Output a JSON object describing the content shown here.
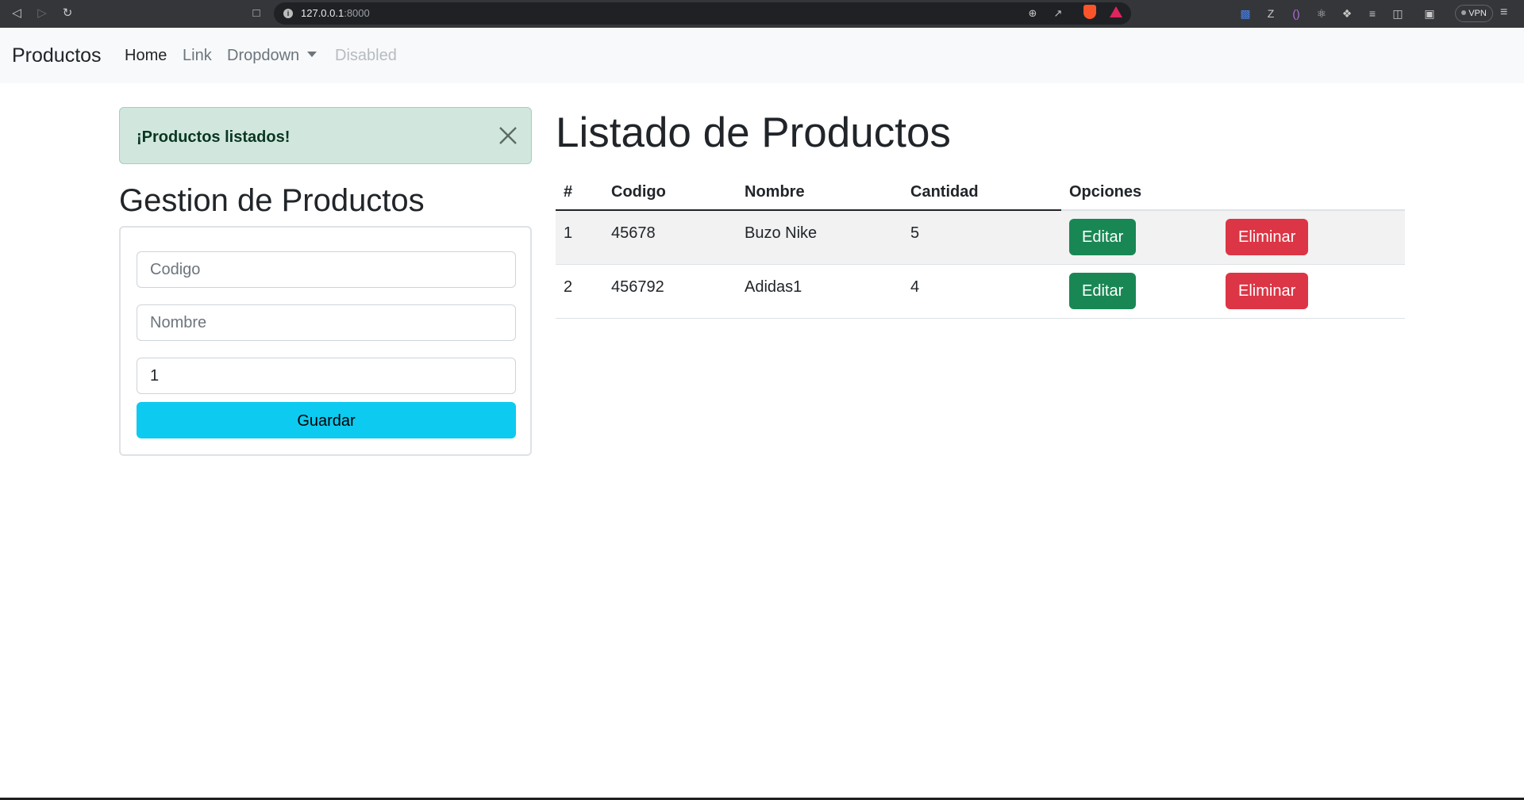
{
  "browser": {
    "url_host": "127.0.0.1",
    "url_port": ":8000",
    "vpn_label": "VPN"
  },
  "navbar": {
    "brand": "Productos",
    "links": [
      {
        "label": "Home",
        "state": "active"
      },
      {
        "label": "Link",
        "state": "normal"
      },
      {
        "label": "Dropdown",
        "state": "dropdown"
      },
      {
        "label": "Disabled",
        "state": "disabled"
      }
    ]
  },
  "alert": {
    "message": "¡Productos listados!",
    "color": "#d1e7dd"
  },
  "form": {
    "title": "Gestion de Productos",
    "codigo_placeholder": "Codigo",
    "nombre_placeholder": "Nombre",
    "cantidad_value": "1",
    "submit_label": "Guardar",
    "submit_color": "#0dcaf0"
  },
  "listing": {
    "title": "Listado de Productos",
    "columns": [
      "#",
      "Codigo",
      "Nombre",
      "Cantidad",
      "Opciones"
    ],
    "rows": [
      {
        "num": "1",
        "codigo": "45678",
        "nombre": "Buzo Nike",
        "cantidad": "5"
      },
      {
        "num": "2",
        "codigo": "456792",
        "nombre": "Adidas1",
        "cantidad": "4"
      }
    ],
    "edit_label": "Editar",
    "delete_label": "Eliminar",
    "edit_color": "#198754",
    "delete_color": "#dc3545"
  }
}
